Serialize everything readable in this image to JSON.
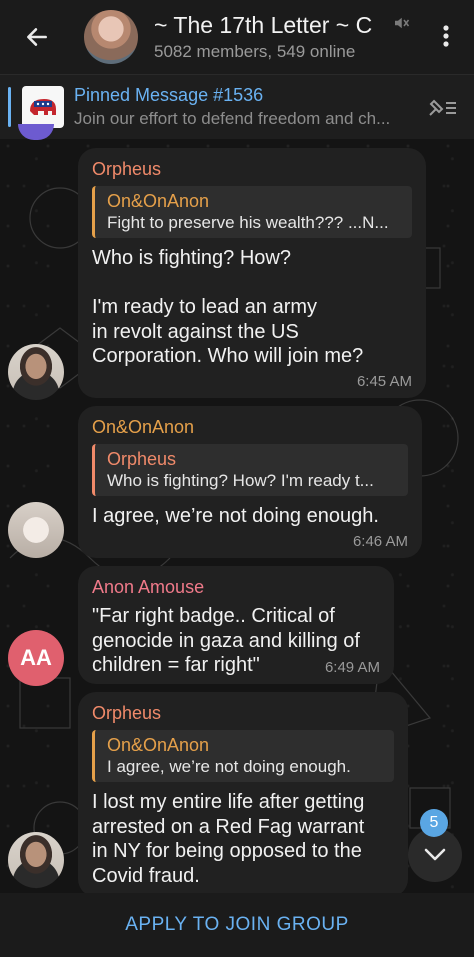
{
  "header": {
    "title": "~ The 17th Letter ~ C",
    "subtitle": "5082 members, 549 online"
  },
  "pinned": {
    "title": "Pinned Message #1536",
    "text": "Join our effort to defend freedom and ch..."
  },
  "messages": [
    {
      "sender": "Orpheus",
      "sender_color": "#f08a6a",
      "reply": {
        "name": "On&OnAnon",
        "text": "Fight to preserve his wealth??? ...N...",
        "color": "#e5a04a"
      },
      "text": "Who is fighting?  How?\n\nI'm ready to lead an army\nin revolt against the US\nCorporation.   Who will join me?",
      "time": "6:45 AM"
    },
    {
      "sender": "On&OnAnon",
      "sender_color": "#e5a04a",
      "reply": {
        "name": "Orpheus",
        "text": "Who is fighting?  How?  I'm ready t...",
        "color": "#f08a6a"
      },
      "text": "I agree, we’re not doing enough.",
      "time": "6:46 AM"
    },
    {
      "sender": "Anon Amouse",
      "sender_color": "#f07a8a",
      "avatar_initials": "AA",
      "text": "\"Far right badge.. Critical of\ngenocide in gaza and killing of\nchildren = far right\"",
      "time": "6:49 AM"
    },
    {
      "sender": "Orpheus",
      "sender_color": "#f08a6a",
      "reply": {
        "name": "On&OnAnon",
        "text": "I agree, we’re not doing enough.",
        "color": "#e5a04a"
      },
      "text": "I lost my entire life after getting\narrested on a Red Fag warrant\nin NY for being opposed to the\nCovid fraud."
    }
  ],
  "scroll_badge": "5",
  "bottom": {
    "join_label": "APPLY TO JOIN GROUP"
  },
  "colors": {
    "accent": "#6ab2f2",
    "bubble": "#212121"
  }
}
